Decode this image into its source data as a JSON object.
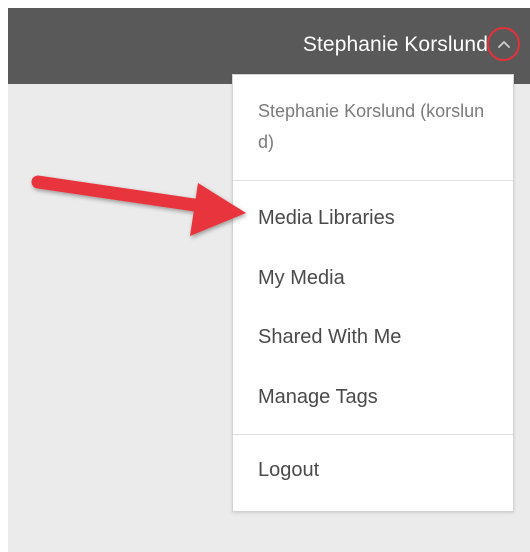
{
  "header": {
    "user_name": "Stephanie Korslund",
    "menu_toggle_icon": "chevron-up-icon"
  },
  "user_menu": {
    "account_label": "Stephanie Korslund (korslund)",
    "items": [
      {
        "label": "Media Libraries"
      },
      {
        "label": "My Media"
      },
      {
        "label": "Shared With Me"
      },
      {
        "label": "Manage Tags"
      }
    ],
    "logout_label": "Logout"
  },
  "colors": {
    "topbar": "#595959",
    "highlight": "#e8303a",
    "background": "#ebebeb"
  }
}
